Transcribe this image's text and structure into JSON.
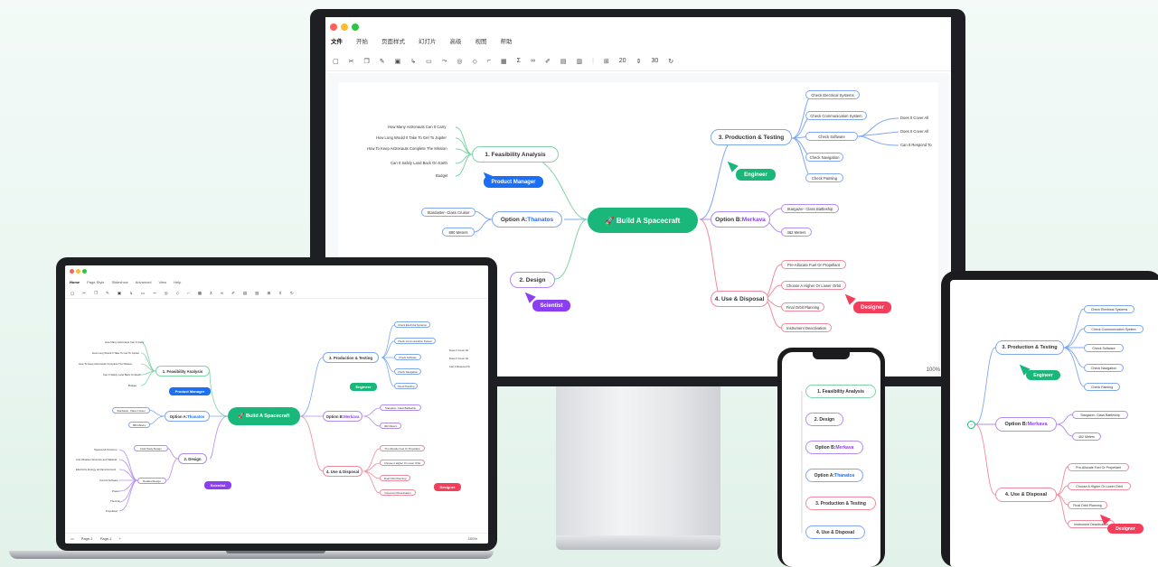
{
  "colors": {
    "green": "#19b87a",
    "blue": "#1a6ff5",
    "purple": "#8b3ff0",
    "red": "#f23e5b"
  },
  "desktop": {
    "menu": [
      "文件",
      "开始",
      "页面样式",
      "幻灯片",
      "高级",
      "视图",
      "帮助"
    ],
    "toolbar_icons": [
      "clipboard-icon",
      "cut-icon",
      "copy-icon",
      "format-brush-icon",
      "topic-icon",
      "subtopic-icon",
      "floating-topic-icon",
      "relationship-icon",
      "comment-icon",
      "tag-icon",
      "summary-icon",
      "image-icon",
      "formula-icon",
      "link-icon",
      "pen-icon",
      "note-icon",
      "table-icon",
      "width-icon",
      "spacing-icon",
      "redo-icon"
    ],
    "toolbar_values": [
      "20",
      "30"
    ],
    "zoom": "100%",
    "center": "Build A Spacecraft",
    "branches": {
      "feasibility": "1. Feasibility Analysis",
      "optionA_prefix": "Option A: ",
      "optionA_name": "Thanatos",
      "design": "2. Design",
      "production": "3. Production & Testing",
      "optionB_prefix": "Option B: ",
      "optionB_name": "Merkava",
      "use": "4. Use & Disposal"
    },
    "feasibility_leaves": [
      "How Many Astronauts Can It Carry",
      "How Long Would It Take To Get To Jupiter",
      "How To Keep Astronauts Complete The Mission",
      "Can It Safely Land Back On Earth",
      "Budget"
    ],
    "optionA_leaves": [
      "Stardaster- Class Cruiser",
      "880 Meters"
    ],
    "production_leaves": [
      "Check Electrical Systems",
      "Check Communication System",
      "Check Software",
      "Check Navigation",
      "Check Painting"
    ],
    "software_leaves": [
      "Does It Cover All",
      "Does It Cover All",
      "Can It Respond To"
    ],
    "optionB_leaves": [
      "Stargazer- Class Battleship",
      "462 Meters"
    ],
    "use_leaves": [
      "Pre-Allocate Fuel Or Propellant",
      "Choose A Higher Or Lower Orbit",
      "Final Orbit Planning",
      "Instrument Deactivation"
    ],
    "tags": {
      "pm": "Product Manager",
      "eng": "Engineer",
      "sci": "Scientist",
      "des": "Designer"
    }
  },
  "laptop": {
    "menu": [
      "Home",
      "Page Style",
      "Slideshow",
      "Advanced",
      "View",
      "Help"
    ],
    "footer": [
      "Page-1",
      "Page-1",
      "+",
      "100%"
    ],
    "design_leaves": [
      "Field Study Design",
      "Detailed Design"
    ],
    "design_sub": [
      "Spacecraft Structure",
      "Anti-Vibration Structure and Material",
      "Electricity, Energy and Environment",
      "Control Software",
      "Power",
      "Thermal",
      "Propulsion"
    ]
  },
  "phone": {
    "items": [
      "1. Feasibility Analysis",
      "2. Design",
      "Option B: Merkava",
      "Option A: Thanatos",
      "3. Production & Testing",
      "4. Use & Disposal"
    ],
    "optionB_prefix": "Option B: ",
    "optionB_name": "Merkava",
    "optionA_prefix": "Option A: ",
    "optionA_name": "Thanatos"
  }
}
